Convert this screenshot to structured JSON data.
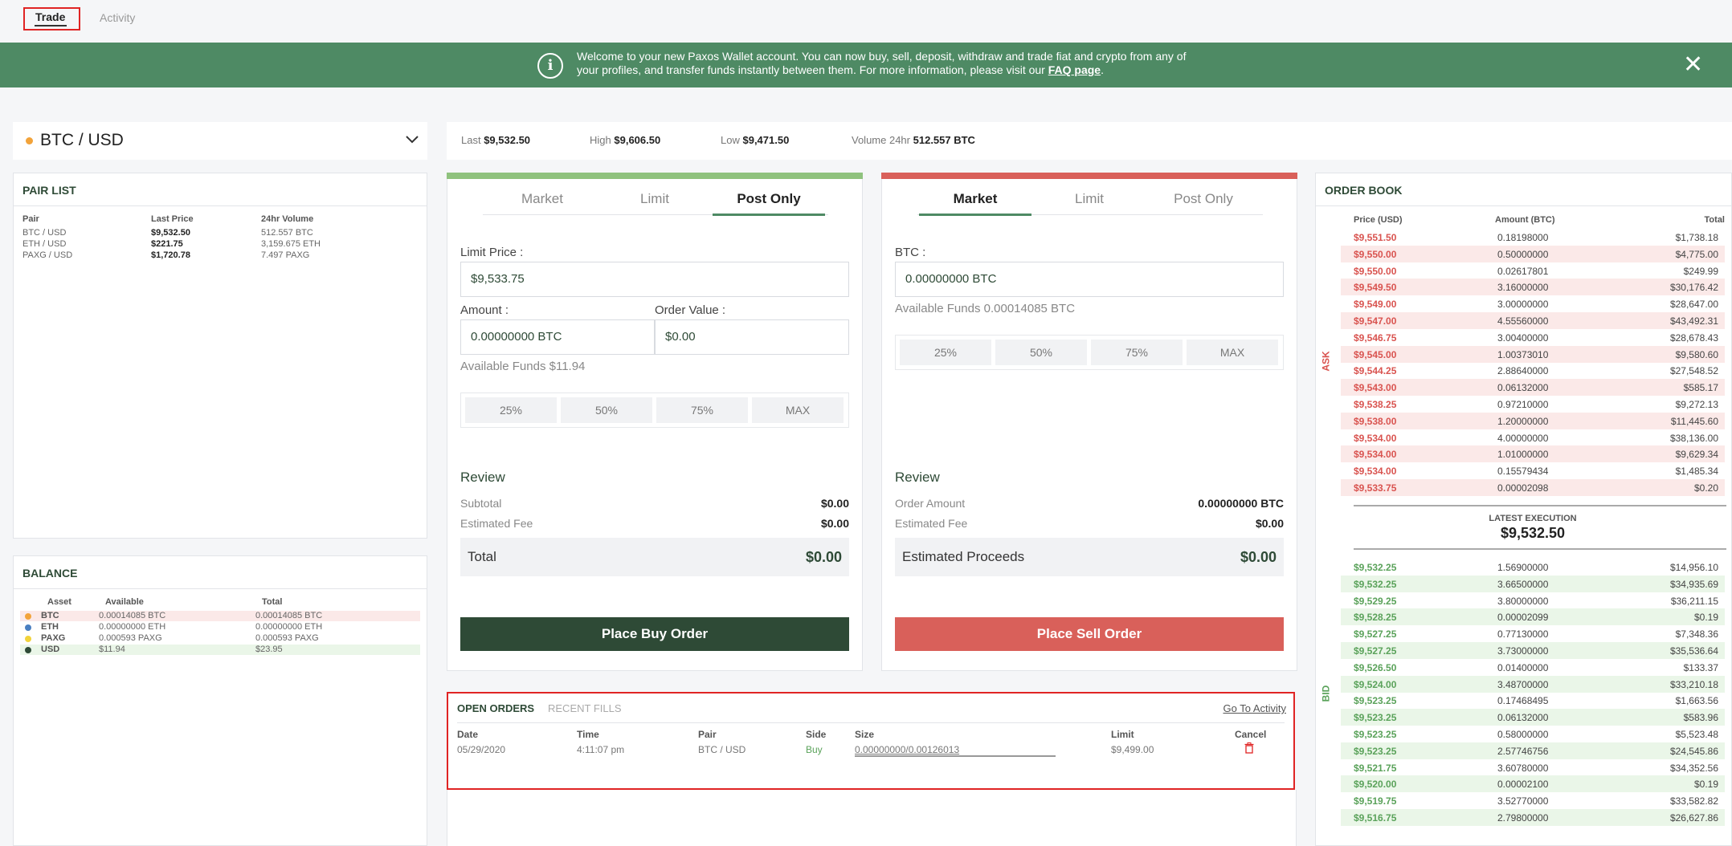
{
  "top_tabs": {
    "trade": "Trade",
    "activity": "Activity"
  },
  "banner": {
    "icon": "i",
    "text": "Welcome to your new Paxos Wallet account. You can now buy, sell, deposit, withdraw and trade fiat and crypto from any of your profiles, and transfer funds instantly between them. For more information, please visit our ",
    "link": "FAQ page",
    "end": ".",
    "close": "✕"
  },
  "pair_selector": {
    "label": "BTC / USD",
    "chevron": "⌵"
  },
  "stats": {
    "last_label": "Last",
    "last_value": "$9,532.50",
    "high_label": "High",
    "high_value": "$9,606.50",
    "low_label": "Low",
    "low_value": "$9,471.50",
    "volume_label": "Volume 24hr",
    "volume_value": "512.557 BTC"
  },
  "pair_list": {
    "title": "PAIR LIST",
    "headers": [
      "Pair",
      "Last Price",
      "24hr Volume"
    ],
    "rows": [
      [
        "BTC / USD",
        "$9,532.50",
        "512.557 BTC"
      ],
      [
        "ETH / USD",
        "$221.75",
        "3,159.675 ETH"
      ],
      [
        "PAXG / USD",
        "$1,720.78",
        "7.497 PAXG"
      ]
    ]
  },
  "balance": {
    "title": "BALANCE",
    "headers": [
      "Asset",
      "Available",
      "Total"
    ],
    "rows": [
      {
        "asset": "BTC",
        "available": "0.00014085 BTC",
        "total": "0.00014085 BTC",
        "dot": "#f2a33a",
        "bg": "#fbe9e8"
      },
      {
        "asset": "ETH",
        "available": "0.00000000 ETH",
        "total": "0.00000000 ETH",
        "dot": "#4a7fc1",
        "bg": "#ffffff"
      },
      {
        "asset": "PAXG",
        "available": "0.000593 PAXG",
        "total": "0.000593 PAXG",
        "dot": "#f2d33a",
        "bg": "#ffffff"
      },
      {
        "asset": "USD",
        "available": "$11.94",
        "total": "$23.95",
        "dot": "#2e4a36",
        "bg": "#eaf6e8"
      }
    ]
  },
  "buy_form": {
    "tabs": [
      "Market",
      "Limit",
      "Post Only"
    ],
    "limit_price_label": "Limit Price :",
    "limit_price_value": "$9,533.75",
    "amount_label": "Amount :",
    "amount_value": "0.00000000 BTC",
    "order_value_label": "Order Value :",
    "order_value_value": "$0.00",
    "available": "Available Funds $11.94",
    "pcts": [
      "25%",
      "50%",
      "75%",
      "MAX"
    ],
    "review": "Review",
    "subtotal_label": "Subtotal",
    "subtotal_value": "$0.00",
    "fee_label": "Estimated Fee",
    "fee_value": "$0.00",
    "total_label": "Total",
    "total_value": "$0.00",
    "button": "Place Buy Order"
  },
  "sell_form": {
    "tabs": [
      "Market",
      "Limit",
      "Post Only"
    ],
    "btc_label": "BTC :",
    "btc_value": "0.00000000 BTC",
    "available": "Available Funds 0.00014085 BTC",
    "pcts": [
      "25%",
      "50%",
      "75%",
      "MAX"
    ],
    "review": "Review",
    "order_amount_label": "Order Amount",
    "order_amount_value": "0.00000000 BTC",
    "fee_label": "Estimated Fee",
    "fee_value": "$0.00",
    "proceeds_label": "Estimated Proceeds",
    "proceeds_value": "$0.00",
    "button": "Place Sell Order"
  },
  "open_orders": {
    "tab_open": "OPEN ORDERS",
    "tab_fills": "RECENT FILLS",
    "go_to": "Go To Activity",
    "headers": [
      "Date",
      "Time",
      "Pair",
      "Side",
      "Size",
      "Limit",
      "Cancel"
    ],
    "row": {
      "date": "05/29/2020",
      "time": "4:11:07 pm",
      "pair": "BTC / USD",
      "side": "Buy",
      "size": "0.00000000/0.00126013",
      "limit": "$9,499.00",
      "size_progress": 0
    }
  },
  "order_book": {
    "title": "ORDER BOOK",
    "headers": [
      "Price (USD)",
      "Amount (BTC)",
      "Total"
    ],
    "ask_label": "ASK",
    "bid_label": "BID",
    "latest_label": "LATEST EXECUTION",
    "latest_value": "$9,532.50",
    "asks": [
      [
        "$9,551.50",
        "0.18198000",
        "$1,738.18"
      ],
      [
        "$9,550.00",
        "0.50000000",
        "$4,775.00"
      ],
      [
        "$9,550.00",
        "0.02617801",
        "$249.99"
      ],
      [
        "$9,549.50",
        "3.16000000",
        "$30,176.42"
      ],
      [
        "$9,549.00",
        "3.00000000",
        "$28,647.00"
      ],
      [
        "$9,547.00",
        "4.55560000",
        "$43,492.31"
      ],
      [
        "$9,546.75",
        "3.00400000",
        "$28,678.43"
      ],
      [
        "$9,545.00",
        "1.00373010",
        "$9,580.60"
      ],
      [
        "$9,544.25",
        "2.88640000",
        "$27,548.52"
      ],
      [
        "$9,543.00",
        "0.06132000",
        "$585.17"
      ],
      [
        "$9,538.25",
        "0.97210000",
        "$9,272.13"
      ],
      [
        "$9,538.00",
        "1.20000000",
        "$11,445.60"
      ],
      [
        "$9,534.00",
        "4.00000000",
        "$38,136.00"
      ],
      [
        "$9,534.00",
        "1.01000000",
        "$9,629.34"
      ],
      [
        "$9,534.00",
        "0.15579434",
        "$1,485.34"
      ],
      [
        "$9,533.75",
        "0.00002098",
        "$0.20"
      ]
    ],
    "bids": [
      [
        "$9,532.25",
        "1.56900000",
        "$14,956.10"
      ],
      [
        "$9,532.25",
        "3.66500000",
        "$34,935.69"
      ],
      [
        "$9,529.25",
        "3.80000000",
        "$36,211.15"
      ],
      [
        "$9,528.25",
        "0.00002099",
        "$0.19"
      ],
      [
        "$9,527.25",
        "0.77130000",
        "$7,348.36"
      ],
      [
        "$9,527.25",
        "3.73000000",
        "$35,536.64"
      ],
      [
        "$9,526.50",
        "0.01400000",
        "$133.37"
      ],
      [
        "$9,524.00",
        "3.48700000",
        "$33,210.18"
      ],
      [
        "$9,523.25",
        "0.17468495",
        "$1,663.56"
      ],
      [
        "$9,523.25",
        "0.06132000",
        "$583.96"
      ],
      [
        "$9,523.25",
        "0.58000000",
        "$5,523.48"
      ],
      [
        "$9,523.25",
        "2.57746756",
        "$24,545.86"
      ],
      [
        "$9,521.75",
        "3.60780000",
        "$34,352.56"
      ],
      [
        "$9,520.00",
        "0.00002100",
        "$0.19"
      ],
      [
        "$9,519.75",
        "3.52770000",
        "$33,582.82"
      ],
      [
        "$9,516.75",
        "2.79800000",
        "$26,627.86"
      ]
    ]
  },
  "colors": {
    "brand_green": "#2e4a36",
    "banner_green": "#4e8a64",
    "sell_red": "#d9605a",
    "ask_red": "#d9534f",
    "bid_green": "#5aa25a"
  }
}
